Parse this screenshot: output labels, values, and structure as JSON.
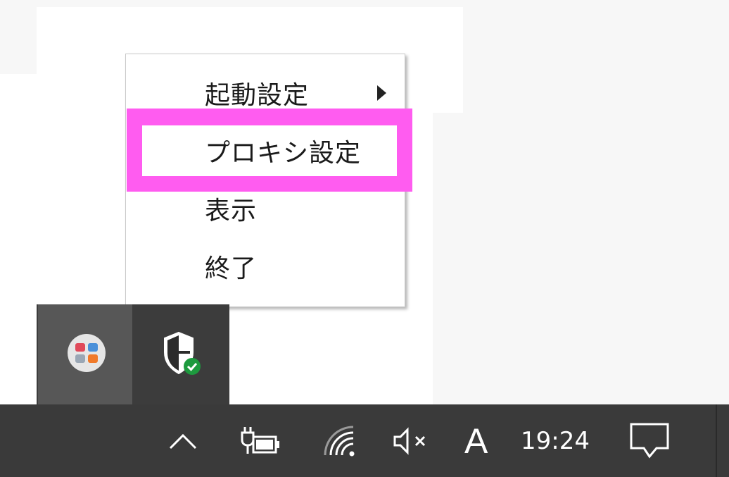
{
  "context_menu": {
    "items": [
      {
        "label": "起動設定",
        "has_submenu": true
      },
      {
        "label": "プロキシ設定",
        "has_submenu": false
      },
      {
        "label": "表示",
        "has_submenu": false
      },
      {
        "label": "終了",
        "has_submenu": false
      }
    ]
  },
  "highlight": {
    "target": "プロキシ設定",
    "color": "#ff5cf0"
  },
  "tray_overflow": {
    "icons": [
      "app-icon",
      "windows-security-shield-icon"
    ]
  },
  "taskbar": {
    "icons": [
      "chevron-up-icon",
      "battery-plug-icon",
      "wifi-icon",
      "volume-muted-icon"
    ],
    "ime_indicator": "A",
    "clock": "19:24",
    "notification_icon": "action-center-icon"
  }
}
